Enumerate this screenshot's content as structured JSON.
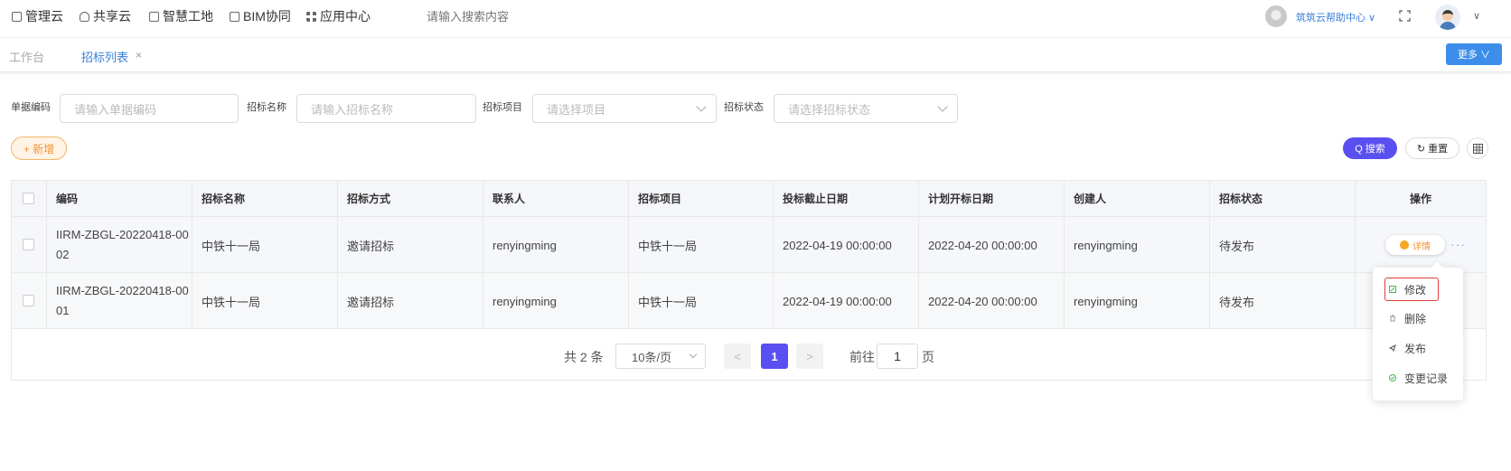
{
  "topnav": {
    "items": [
      "管理云",
      "共享云",
      "智慧工地",
      "BIM协同",
      "应用中心"
    ],
    "search_placeholder": "请输入搜索内容",
    "help_label": "筑筑云帮助中心 ∨"
  },
  "tabs": {
    "workbench": "工作台",
    "active": "招标列表",
    "close": "×",
    "more_label": "更多 ∨"
  },
  "filters": {
    "code_label": "单据编码",
    "code_placeholder": "请输入单据编码",
    "name_label": "招标名称",
    "name_placeholder": "请输入招标名称",
    "project_label": "招标项目",
    "project_placeholder": "请选择项目",
    "status_label": "招标状态",
    "status_placeholder": "请选择招标状态"
  },
  "actions": {
    "add_label": "+ 新增",
    "search_label": "Q 搜索",
    "reset_label": "↻ 重置"
  },
  "table": {
    "headers": [
      "编码",
      "招标名称",
      "招标方式",
      "联系人",
      "招标项目",
      "投标截止日期",
      "计划开标日期",
      "创建人",
      "招标状态",
      "操作"
    ],
    "rows": [
      {
        "code": "IIRM-ZBGL-20220418-0002",
        "name": "中铁十一局",
        "method": "邀请招标",
        "contact": "renyingming",
        "project": "中铁十一局",
        "deadline": "2022-04-19 00:00:00",
        "open_date": "2022-04-20 00:00:00",
        "creator": "renyingming",
        "status": "待发布"
      },
      {
        "code": "IIRM-ZBGL-20220418-0001",
        "name": "中铁十一局",
        "method": "邀请招标",
        "contact": "renyingming",
        "project": "中铁十一局",
        "deadline": "2022-04-19 00:00:00",
        "open_date": "2022-04-20 00:00:00",
        "creator": "renyingming",
        "status": "待发布"
      }
    ],
    "detail_label": "详情",
    "more_dots": "···"
  },
  "pagination": {
    "total": "共 2 条",
    "page_size": "10条/页",
    "prev": "<",
    "current": "1",
    "next": ">",
    "goto_label": "前往",
    "goto_value": "1",
    "unit": "页"
  },
  "dropdown": {
    "edit": "修改",
    "delete": "删除",
    "publish": "发布",
    "history": "变更记录"
  },
  "colors": {
    "primary": "#5a4ff0",
    "link": "#3a7fd8",
    "accent_orange": "#f29234",
    "highlight_border": "#e23b3b"
  }
}
